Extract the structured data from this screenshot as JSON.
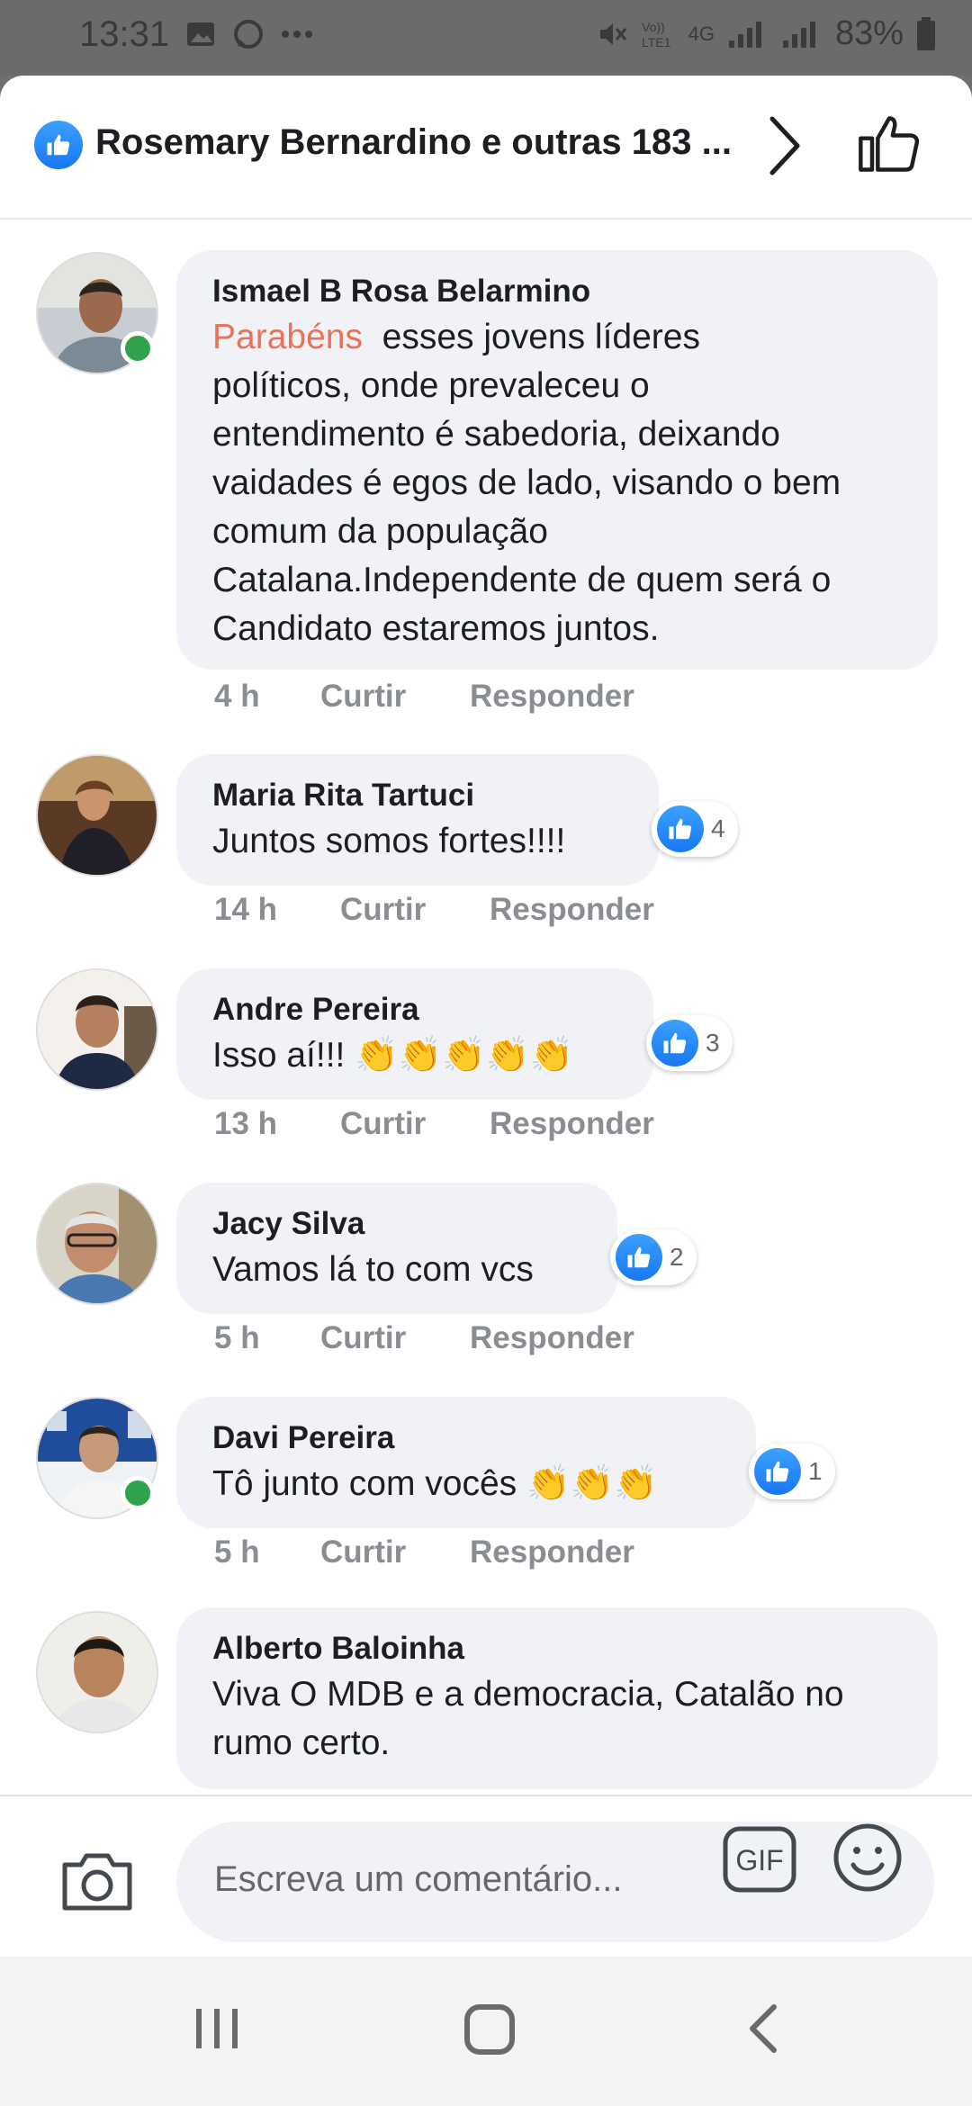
{
  "status_bar": {
    "time": "13:31",
    "network": "4G",
    "battery": "83%"
  },
  "header": {
    "title": "Rosemary Bernardino e outras 183 ..."
  },
  "comments": [
    {
      "author": "Ismael B Rosa Belarmino",
      "highlight": "Parabéns",
      "lines": [
        "esses jovens líderes",
        "políticos, onde prevaleceu o",
        "entendimento é sabedoria, deixando",
        "vaidades é egos de lado, visando o bem",
        "comum da população",
        "Catalana.Independente de quem será  o",
        "Candidato  estaremos juntos."
      ],
      "time": "4 h",
      "like": "Curtir",
      "reply": "Responder"
    },
    {
      "author": "Maria Rita Tartuci",
      "text": "Juntos somos fortes!!!!",
      "reactions": "4",
      "time": "14 h",
      "like": "Curtir",
      "reply": "Responder"
    },
    {
      "author": "Andre Pereira",
      "text": "Isso aí!!! 👏👏👏👏👏",
      "reactions": "3",
      "time": "13 h",
      "like": "Curtir",
      "reply": "Responder"
    },
    {
      "author": "Jacy Silva",
      "text": "Vamos lá to com vcs",
      "reactions": "2",
      "time": "5 h",
      "like": "Curtir",
      "reply": "Responder"
    },
    {
      "author": "Davi Pereira",
      "text": "Tô junto com vocês 👏👏👏",
      "reactions": "1",
      "time": "5 h",
      "like": "Curtir",
      "reply": "Responder"
    },
    {
      "author": "Alberto Baloinha",
      "lines": [
        "Viva O MDB e a democracia, Catalão no",
        "rumo certo."
      ]
    }
  ],
  "composer": {
    "placeholder": "Escreva um comentário...",
    "gif_label": "GIF"
  },
  "colors": {
    "facebook_blue": "#1877f2",
    "bubble_bg": "#f0f2f5",
    "highlight": "#e8735a",
    "online": "#31a24c"
  }
}
